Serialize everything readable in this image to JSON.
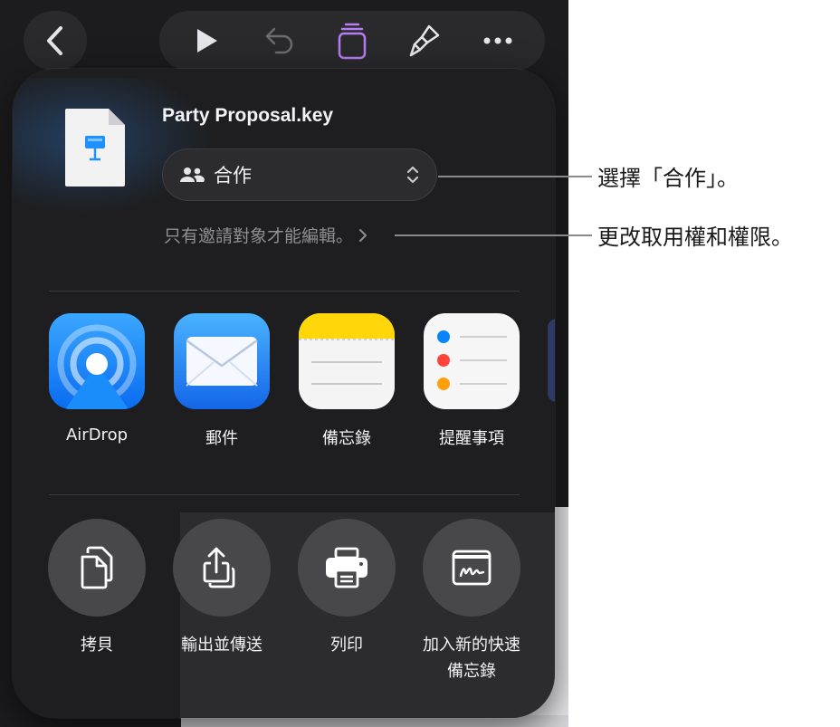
{
  "file": {
    "name": "Party Proposal.key"
  },
  "collab": {
    "mode": "合作"
  },
  "access": {
    "text": "只有邀請對象才能編輯。"
  },
  "apps": [
    {
      "label": "AirDrop"
    },
    {
      "label": "郵件"
    },
    {
      "label": "備忘錄"
    },
    {
      "label": "提醒事項"
    }
  ],
  "actions": [
    {
      "label": "拷貝"
    },
    {
      "label": "輸出並傳送"
    },
    {
      "label": "列印"
    },
    {
      "label": "加入新的快速\n備忘錄"
    }
  ],
  "callouts": {
    "collab": "選擇「合作」。",
    "access": "更改取用權和權限。"
  },
  "toolbar": {
    "icons": [
      "chevron-left-icon",
      "play-icon",
      "undo-icon",
      "document-stack-icon",
      "paintbrush-icon",
      "more-icon"
    ]
  },
  "colors": {
    "accent_purple": "#b57cf4",
    "airdrop_blue": "#1b8dfb",
    "notes_yellow": "#ffd60a"
  }
}
